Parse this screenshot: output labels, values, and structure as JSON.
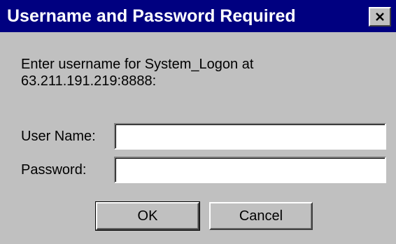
{
  "window": {
    "title": "Username and Password Required"
  },
  "message": {
    "line1": "Enter username for System_Logon at",
    "line2": "63.211.191.219:8888:"
  },
  "fields": {
    "username_label": "User Name:",
    "username_value": "",
    "password_label": "Password:",
    "password_value": ""
  },
  "buttons": {
    "ok_label": "OK",
    "cancel_label": "Cancel"
  },
  "icons": {
    "close": "close-icon"
  },
  "colors": {
    "titlebar": "#000080",
    "face": "#c0c0c0",
    "title_text": "#ffffff"
  }
}
